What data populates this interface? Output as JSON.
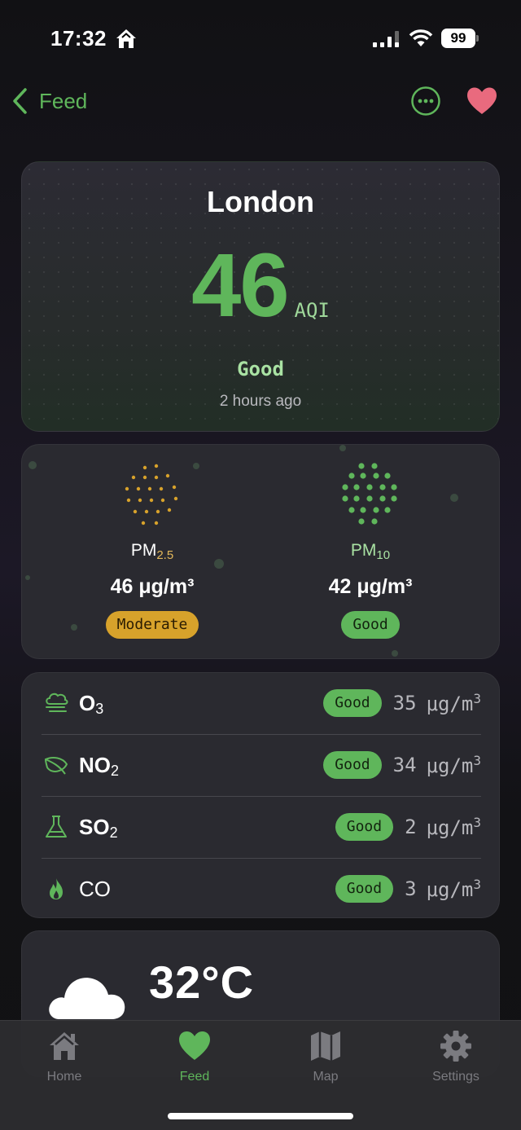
{
  "status_bar": {
    "time": "17:32",
    "battery": "99"
  },
  "nav": {
    "back_label": "Feed"
  },
  "aqi_card": {
    "city": "London",
    "aqi_value": "46",
    "aqi_unit": "AQI",
    "status": "Good",
    "updated": "2 hours ago"
  },
  "pm": [
    {
      "label": "PM",
      "sub": "2.5",
      "value": "46 μg/m³",
      "badge": "Moderate",
      "level": "moderate"
    },
    {
      "label": "PM",
      "sub": "10",
      "value": "42 μg/m³",
      "badge": "Good",
      "level": "good"
    }
  ],
  "gases": [
    {
      "name": "O",
      "sub": "3",
      "icon": "cloud-haze-icon",
      "badge": "Good",
      "value": "35",
      "unit": "μg/m",
      "unit_sup": "3"
    },
    {
      "name": "NO",
      "sub": "2",
      "icon": "leaf-icon",
      "badge": "Good",
      "value": "34",
      "unit": "μg/m",
      "unit_sup": "3"
    },
    {
      "name": "SO",
      "sub": "2",
      "icon": "flask-icon",
      "badge": "Good",
      "value": "2",
      "unit": "μg/m",
      "unit_sup": "3"
    },
    {
      "name": "CO",
      "sub": "",
      "icon": "flame-icon",
      "badge": "Good",
      "value": "3",
      "unit": "μg/m",
      "unit_sup": "3"
    }
  ],
  "weather": {
    "temperature": "32°C"
  },
  "tabs": [
    {
      "label": "Home",
      "icon": "house-icon",
      "active": false
    },
    {
      "label": "Feed",
      "icon": "heart-icon",
      "active": true
    },
    {
      "label": "Map",
      "icon": "map-icon",
      "active": false
    },
    {
      "label": "Settings",
      "icon": "gear-icon",
      "active": false
    }
  ],
  "colors": {
    "accent": "#5fb65b",
    "moderate": "#d7a22b",
    "heart": "#e96a7e",
    "background": "#111114"
  }
}
